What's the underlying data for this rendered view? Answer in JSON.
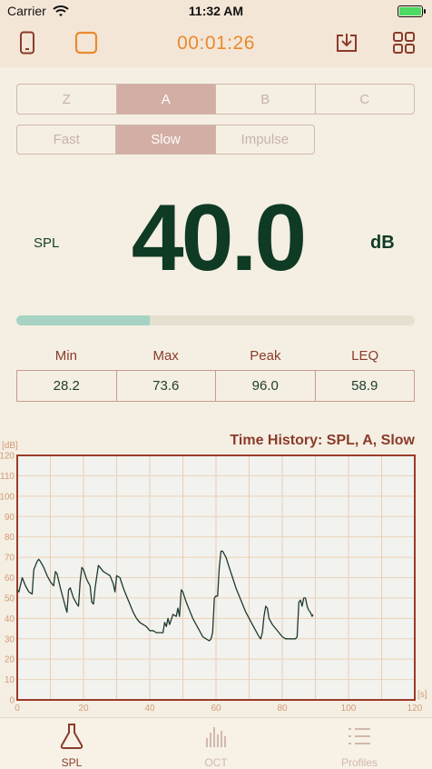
{
  "status_bar": {
    "carrier": "Carrier",
    "time": "11:32 AM"
  },
  "nav": {
    "timer": "00:01:26"
  },
  "weighting": {
    "options": [
      "Z",
      "A",
      "B",
      "C"
    ],
    "selected": "A"
  },
  "response": {
    "options": [
      "Fast",
      "Slow",
      "Impulse"
    ],
    "selected": "Slow"
  },
  "reading": {
    "label": "SPL",
    "value": "40.0",
    "unit": "dB",
    "level_fraction": 0.335
  },
  "stats": {
    "headers": [
      "Min",
      "Max",
      "Peak",
      "LEQ"
    ],
    "values": [
      "28.2",
      "73.6",
      "96.0",
      "58.9"
    ]
  },
  "colors": {
    "accent": "#e98a2f",
    "brand": "#8a3b2b",
    "value": "#0f3a24",
    "selected": "#d3aea4",
    "level": "#a6d3c3"
  },
  "chart_data": {
    "type": "line",
    "title": "Time History: SPL, A, Slow",
    "ylabel": "[dB]",
    "xlabel": "[s]",
    "xlim": [
      0,
      120
    ],
    "ylim": [
      0,
      120
    ],
    "x_ticks": [
      0,
      20,
      40,
      60,
      80,
      100,
      120
    ],
    "y_ticks": [
      0,
      10,
      20,
      30,
      40,
      50,
      60,
      70,
      80,
      90,
      100,
      110,
      120
    ],
    "grid": true,
    "series": [
      {
        "points": [
          [
            0,
            54
          ],
          [
            0.5,
            53
          ],
          [
            1.5,
            60
          ],
          [
            2.5,
            56
          ],
          [
            3.5,
            53
          ],
          [
            4.5,
            52
          ],
          [
            5,
            64
          ],
          [
            6,
            68
          ],
          [
            6.5,
            69
          ],
          [
            7,
            68
          ],
          [
            8,
            65
          ],
          [
            9,
            61
          ],
          [
            10,
            58
          ],
          [
            11,
            56
          ],
          [
            11.5,
            63
          ],
          [
            12,
            62
          ],
          [
            13,
            55
          ],
          [
            14,
            49
          ],
          [
            14.5,
            46
          ],
          [
            15,
            43
          ],
          [
            15.5,
            54
          ],
          [
            16,
            55
          ],
          [
            17,
            50
          ],
          [
            18,
            47
          ],
          [
            18.5,
            46
          ],
          [
            19,
            58
          ],
          [
            19.5,
            65
          ],
          [
            20,
            64
          ],
          [
            21,
            59
          ],
          [
            22,
            56
          ],
          [
            22.5,
            48
          ],
          [
            23,
            47
          ],
          [
            23.5,
            55
          ],
          [
            24.5,
            66
          ],
          [
            25,
            65
          ],
          [
            26,
            63
          ],
          [
            27,
            62
          ],
          [
            28,
            61
          ],
          [
            29,
            57
          ],
          [
            29.5,
            53
          ],
          [
            30,
            61
          ],
          [
            31,
            60
          ],
          [
            32,
            55
          ],
          [
            33,
            51
          ],
          [
            34,
            47
          ],
          [
            35,
            43
          ],
          [
            36,
            40
          ],
          [
            37,
            38
          ],
          [
            38,
            37
          ],
          [
            39,
            36
          ],
          [
            40,
            34
          ],
          [
            41,
            34
          ],
          [
            42,
            33
          ],
          [
            43,
            33
          ],
          [
            44,
            33
          ],
          [
            44.5,
            38
          ],
          [
            45,
            36
          ],
          [
            45.5,
            40
          ],
          [
            46,
            37
          ],
          [
            47,
            42
          ],
          [
            48,
            41
          ],
          [
            48.5,
            45
          ],
          [
            49,
            41
          ],
          [
            49.5,
            54
          ],
          [
            50,
            53
          ],
          [
            51,
            48
          ],
          [
            52,
            44
          ],
          [
            53,
            40
          ],
          [
            54,
            37
          ],
          [
            55,
            34
          ],
          [
            56,
            31
          ],
          [
            57,
            30
          ],
          [
            58,
            29
          ],
          [
            58.5,
            30
          ],
          [
            59,
            33
          ],
          [
            59.5,
            50
          ],
          [
            60,
            51
          ],
          [
            60.5,
            51
          ],
          [
            61,
            65
          ],
          [
            61.5,
            73
          ],
          [
            62,
            73
          ],
          [
            63,
            70
          ],
          [
            64,
            65
          ],
          [
            65,
            60
          ],
          [
            66,
            55
          ],
          [
            67,
            51
          ],
          [
            68,
            47
          ],
          [
            69,
            43
          ],
          [
            70,
            40
          ],
          [
            71,
            37
          ],
          [
            72,
            34
          ],
          [
            73,
            31
          ],
          [
            73.5,
            30
          ],
          [
            74,
            33
          ],
          [
            74.5,
            41
          ],
          [
            75,
            46
          ],
          [
            75.5,
            45
          ],
          [
            76,
            40
          ],
          [
            77,
            37
          ],
          [
            78,
            35
          ],
          [
            79,
            33
          ],
          [
            80,
            31
          ],
          [
            81,
            30
          ],
          [
            82,
            30
          ],
          [
            83,
            30
          ],
          [
            84,
            30
          ],
          [
            84.5,
            31
          ],
          [
            85,
            48
          ],
          [
            85.5,
            49
          ],
          [
            86,
            46
          ],
          [
            86.5,
            50
          ],
          [
            87,
            50
          ],
          [
            87.5,
            46
          ],
          [
            88,
            44
          ],
          [
            88.5,
            43
          ],
          [
            89,
            41
          ],
          [
            89.3,
            42
          ]
        ]
      }
    ]
  }
}
